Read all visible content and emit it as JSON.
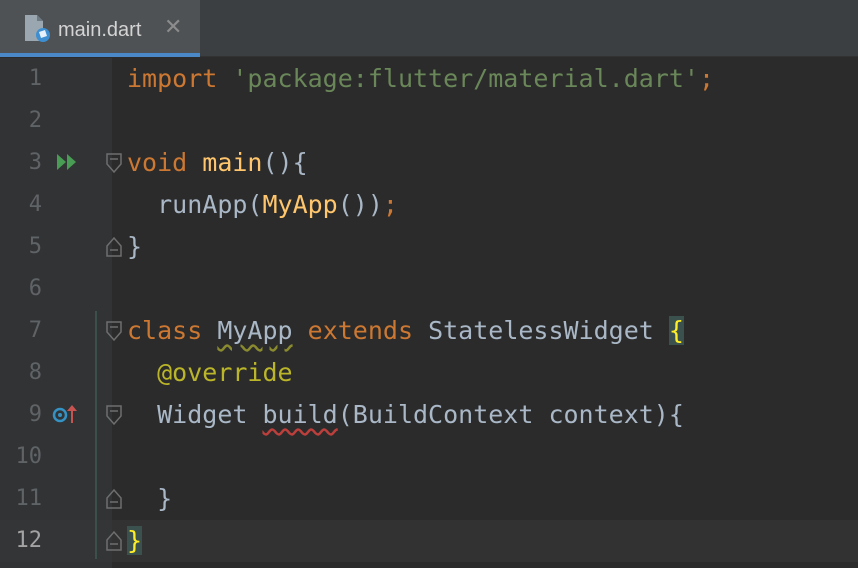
{
  "tab": {
    "title": "main.dart",
    "close_glyph": "✕",
    "icon": "dart-file-icon"
  },
  "line_numbers": [
    "1",
    "2",
    "3",
    "4",
    "5",
    "6",
    "7",
    "8",
    "9",
    "10",
    "11",
    "12"
  ],
  "current_line": "12",
  "code": {
    "l1_import": "import",
    "l1_str": "'package:flutter/material.dart'",
    "l1_semi": ";",
    "l3_void": "void",
    "l3_main": "main",
    "l3_rest": "(){",
    "l4_indent": "  ",
    "l4_run": "runApp(",
    "l4_myapp": "MyApp",
    "l4_close": "())",
    "l4_semi": ";",
    "l5_brace": "}",
    "l7_class": "class",
    "l7_sp1": " ",
    "l7_myapp": "MyApp",
    "l7_sp2": " ",
    "l7_extends": "extends",
    "l7_sw": " StatelessWidget ",
    "l7_brace": "{",
    "l8_indent": "  ",
    "l8_override": "@override",
    "l9_indent": "  ",
    "l9_widget": "Widget ",
    "l9_build": "build",
    "l9_rest": "(BuildContext context){",
    "l11": "  }",
    "l12_brace": "}"
  },
  "colors": {
    "background": "#2b2b2b",
    "keyword": "#cc7832",
    "string": "#6a8759",
    "function": "#ffc66d",
    "annotation": "#bbb529",
    "text": "#a9b7c6",
    "accent": "#4a88c7"
  }
}
